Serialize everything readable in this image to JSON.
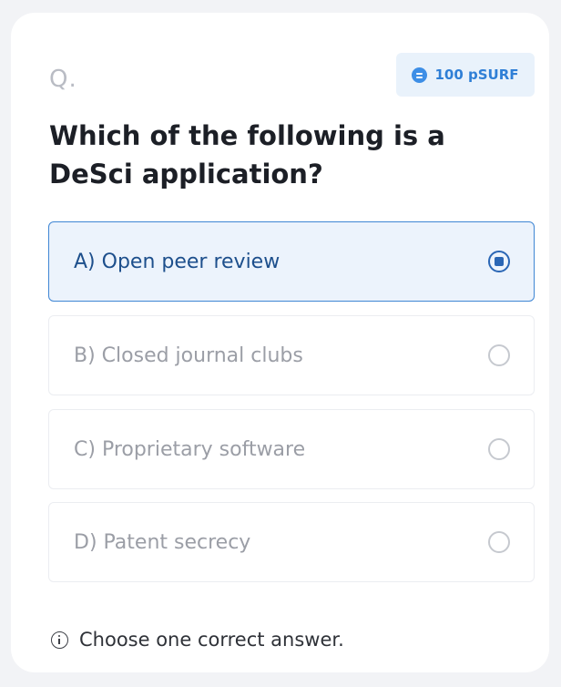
{
  "question_marker": "Q.",
  "reward": {
    "icon": "coin-icon",
    "label": "100 pSURF"
  },
  "question": "Which of the following is a DeSci application?",
  "options": [
    {
      "label": "A) Open peer review",
      "selected": true
    },
    {
      "label": "B) Closed journal clubs",
      "selected": false
    },
    {
      "label": "C) Proprietary software",
      "selected": false
    },
    {
      "label": "D) Patent secrecy",
      "selected": false
    }
  ],
  "hint": {
    "icon": "info-icon",
    "text": "Choose one correct answer."
  },
  "colors": {
    "accent": "#3f86d4",
    "selected_bg": "#ecf3fc",
    "reward_bg": "#e9f2fb"
  }
}
